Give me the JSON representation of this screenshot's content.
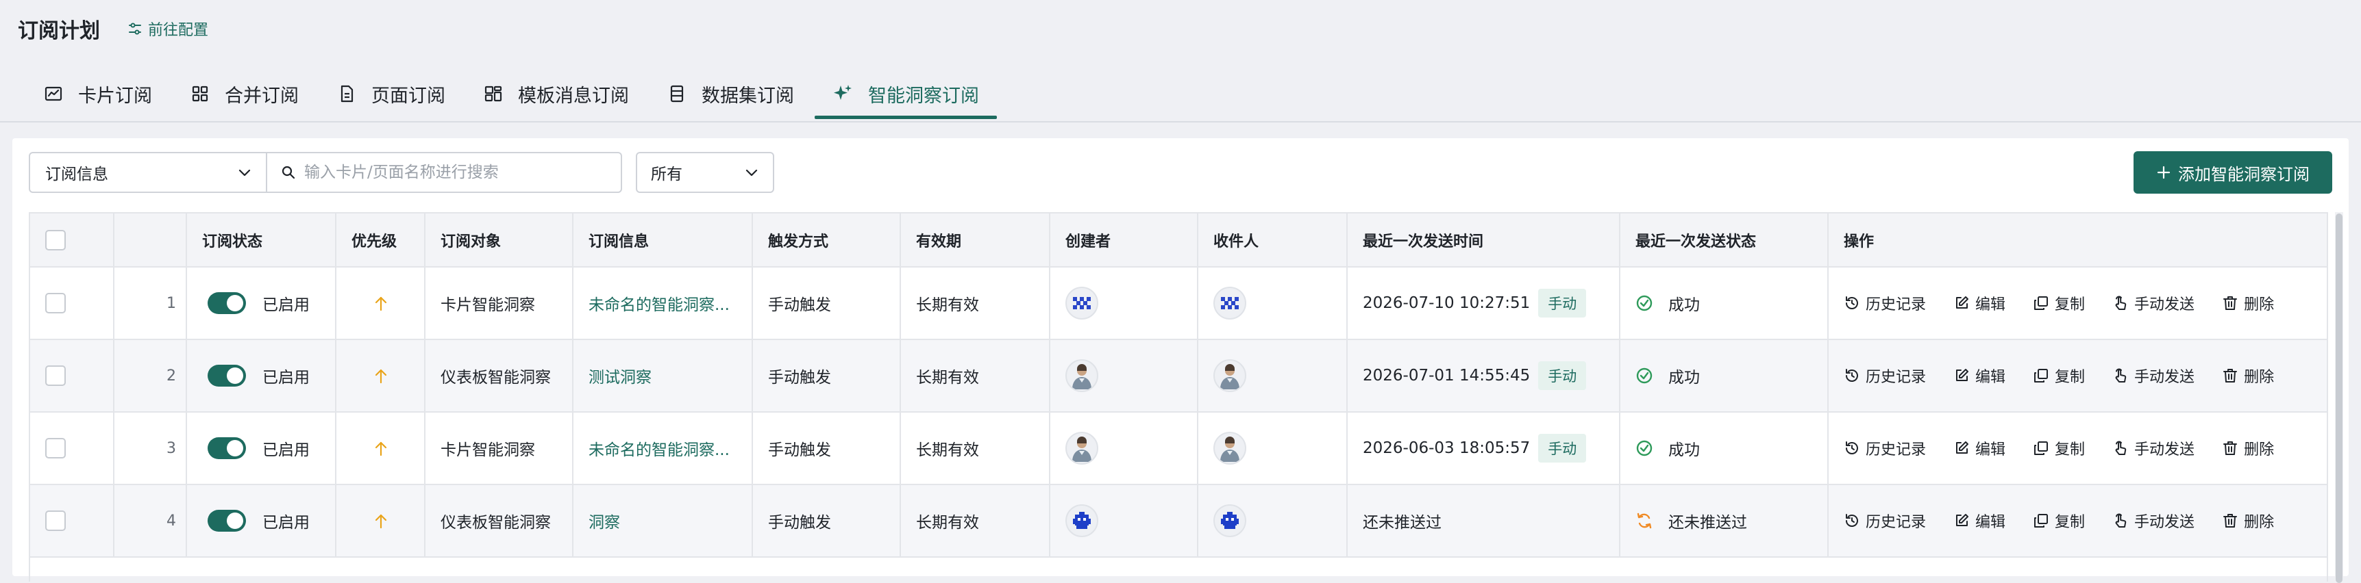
{
  "header": {
    "title": "订阅计划",
    "config_link": "前往配置"
  },
  "tabs": [
    {
      "label": "卡片订阅",
      "icon": "chart-line-icon",
      "active": false
    },
    {
      "label": "合并订阅",
      "icon": "grid-icon",
      "active": false
    },
    {
      "label": "页面订阅",
      "icon": "document-icon",
      "active": false
    },
    {
      "label": "模板消息订阅",
      "icon": "template-icon",
      "active": false
    },
    {
      "label": "数据集订阅",
      "icon": "dataset-icon",
      "active": false
    },
    {
      "label": "智能洞察订阅",
      "icon": "sparkle-icon",
      "active": true
    }
  ],
  "filters": {
    "field_select": "订阅信息",
    "search_placeholder": "输入卡片/页面名称进行搜索",
    "search_value": "",
    "status_select": "所有",
    "add_button": "添加智能洞察订阅"
  },
  "table": {
    "columns": [
      "",
      "",
      "订阅状态",
      "优先级",
      "订阅对象",
      "订阅信息",
      "触发方式",
      "有效期",
      "创建者",
      "收件人",
      "最近一次发送时间",
      "最近一次发送状态",
      "操作"
    ],
    "rows": [
      {
        "index": "1",
        "status": "已启用",
        "object": "卡片智能洞察",
        "info": "未命名的智能洞察...",
        "trigger": "手动触发",
        "validity": "长期有效",
        "creator_avatar": "pixel",
        "receiver_avatar": "pixel",
        "last_time": "2026-07-10 10:27:51",
        "last_badge": "手动",
        "last_status": "成功",
        "last_status_kind": "success"
      },
      {
        "index": "2",
        "status": "已启用",
        "object": "仪表板智能洞察",
        "info": "测试洞察",
        "trigger": "手动触发",
        "validity": "长期有效",
        "creator_avatar": "person",
        "receiver_avatar": "person",
        "last_time": "2026-07-01 14:55:45",
        "last_badge": "手动",
        "last_status": "成功",
        "last_status_kind": "success"
      },
      {
        "index": "3",
        "status": "已启用",
        "object": "卡片智能洞察",
        "info": "未命名的智能洞察...",
        "trigger": "手动触发",
        "validity": "长期有效",
        "creator_avatar": "person",
        "receiver_avatar": "person",
        "last_time": "2026-06-03 18:05:57",
        "last_badge": "手动",
        "last_status": "成功",
        "last_status_kind": "success"
      },
      {
        "index": "4",
        "status": "已启用",
        "object": "仪表板智能洞察",
        "info": "洞察",
        "trigger": "手动触发",
        "validity": "长期有效",
        "creator_avatar": "robot",
        "receiver_avatar": "robot",
        "last_time": "还未推送过",
        "last_badge": "",
        "last_status": "还未推送过",
        "last_status_kind": "pending"
      }
    ],
    "actions": [
      {
        "label": "历史记录",
        "icon": "history-icon"
      },
      {
        "label": "编辑",
        "icon": "edit-icon"
      },
      {
        "label": "复制",
        "icon": "copy-icon"
      },
      {
        "label": "手动发送",
        "icon": "hand-pointer-icon"
      },
      {
        "label": "删除",
        "icon": "trash-icon"
      }
    ]
  },
  "colors": {
    "primary": "#1d6b5f",
    "priority": "#e9a41a",
    "success": "#2e9a5a",
    "pending": "#f08a24"
  }
}
